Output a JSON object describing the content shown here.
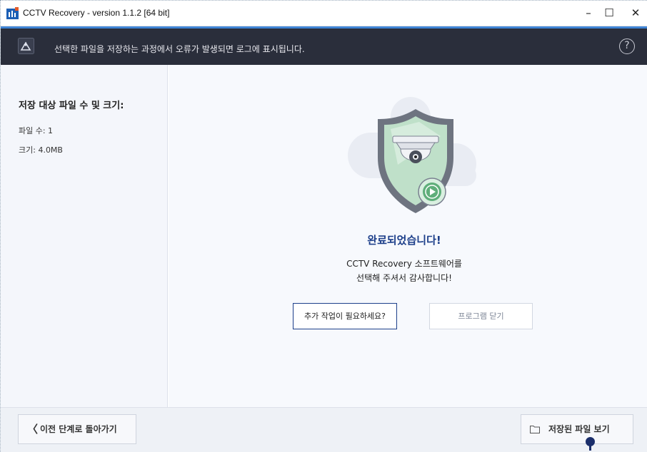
{
  "window": {
    "title": "CCTV Recovery - version 1.1.2 [64 bit]",
    "controls": {
      "minimize": "–",
      "maximize": "☐",
      "close": "✕"
    }
  },
  "banner": {
    "text": "선택한 파일을 저장하는 과정에서 오류가 발생되면 로그에 표시됩니다.",
    "help": "?"
  },
  "sidebar": {
    "heading": "저장 대상 파일 수 및 크기:",
    "file_count": "파일 수: 1",
    "size": "크기: 4.0MB"
  },
  "main": {
    "done_title": "완료되었습니다!",
    "thanks_line1": "CCTV Recovery 소프트웨어를",
    "thanks_line2": "선택해 주셔서 감사합니다!",
    "more_button": "추가 작업이 필요하세요?",
    "close_program_button": "프로그램 닫기"
  },
  "footer": {
    "back_chevron": "〈",
    "back_button": "이전 단계로 돌아가기",
    "view_saved_button": "저장된 파일 보기"
  },
  "colors": {
    "banner_bg": "#2a2e3b",
    "accent": "#1d3f8a",
    "shield": "#6e7480",
    "play_green": "#5fae7a"
  },
  "icons": [
    "app-icon",
    "save-log-icon",
    "help-icon",
    "shield-camera-icon",
    "play-icon",
    "folder-icon",
    "chevron-left-icon"
  ]
}
